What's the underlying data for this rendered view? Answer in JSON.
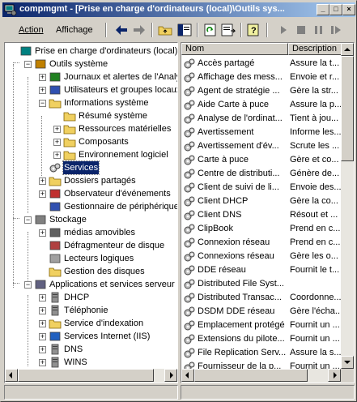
{
  "window": {
    "title": "compmgmt - [Prise en charge d'ordinateurs (local)\\Outils sys...",
    "controls": {
      "minimize": "_",
      "maximize": "□",
      "close": "×"
    }
  },
  "menu": [
    {
      "label": "Action"
    },
    {
      "label": "Affichage"
    }
  ],
  "toolbar": [
    "back-arrow-icon",
    "forward-arrow-icon",
    "up-folder-icon",
    "show-hide-tree-icon",
    "refresh-icon",
    "export-list-icon",
    "help-icon",
    "play-icon",
    "stop-icon",
    "pause-icon",
    "restart-icon"
  ],
  "tree": [
    {
      "label": "Prise en charge d'ordinateurs (local)",
      "icon": "computer-management-icon",
      "expander": ""
    },
    {
      "label": "Outils système",
      "icon": "tools-icon",
      "expander": "−"
    },
    {
      "label": "Journaux et alertes de l'Analyseur",
      "icon": "performance-logs-icon",
      "expander": "+"
    },
    {
      "label": "Utilisateurs et groupes locaux",
      "icon": "users-groups-icon",
      "expander": "+"
    },
    {
      "label": "Informations système",
      "icon": "folder-open-icon",
      "expander": "−"
    },
    {
      "label": "Résumé système",
      "icon": "folder-icon",
      "expander": ""
    },
    {
      "label": "Ressources matérielles",
      "icon": "folder-icon",
      "expander": "+"
    },
    {
      "label": "Composants",
      "icon": "folder-icon",
      "expander": "+"
    },
    {
      "label": "Environnement logiciel",
      "icon": "folder-icon",
      "expander": "+"
    },
    {
      "label": "Services",
      "icon": "services-gear-icon",
      "expander": "",
      "selected": true
    },
    {
      "label": "Dossiers partagés",
      "icon": "shared-folder-icon",
      "expander": "+"
    },
    {
      "label": "Observateur d'événements",
      "icon": "event-viewer-icon",
      "expander": "+"
    },
    {
      "label": "Gestionnaire de périphériques",
      "icon": "device-manager-icon",
      "expander": ""
    },
    {
      "label": "Stockage",
      "icon": "storage-icon",
      "expander": "−"
    },
    {
      "label": "médias amovibles",
      "icon": "removable-media-icon",
      "expander": "+"
    },
    {
      "label": "Défragmenteur de disque",
      "icon": "defrag-icon",
      "expander": ""
    },
    {
      "label": "Lecteurs logiques",
      "icon": "logical-drives-icon",
      "expander": ""
    },
    {
      "label": "Gestion des disques",
      "icon": "disk-management-icon",
      "expander": ""
    },
    {
      "label": "Applications et services serveur",
      "icon": "server-apps-icon",
      "expander": "−"
    },
    {
      "label": "DHCP",
      "icon": "server-icon",
      "expander": "+"
    },
    {
      "label": "Téléphonie",
      "icon": "server-icon",
      "expander": "+"
    },
    {
      "label": "Service d'indexation",
      "icon": "indexing-icon",
      "expander": "+"
    },
    {
      "label": "Services Internet (IIS)",
      "icon": "iis-icon",
      "expander": "+"
    },
    {
      "label": "DNS",
      "icon": "server-icon",
      "expander": "+"
    },
    {
      "label": "WINS",
      "icon": "server-icon",
      "expander": "+"
    }
  ],
  "list": {
    "columns": [
      "Nom",
      "Description"
    ],
    "rows": [
      {
        "name": "Accès partagé",
        "description": "Assure la t..."
      },
      {
        "name": "Affichage des mess...",
        "description": "Envoie et r..."
      },
      {
        "name": "Agent de stratégie ...",
        "description": "Gère la str..."
      },
      {
        "name": "Aide Carte à puce",
        "description": "Assure la p..."
      },
      {
        "name": "Analyse de l'ordinat...",
        "description": "Tient à jou..."
      },
      {
        "name": "Avertissement",
        "description": "Informe les..."
      },
      {
        "name": "Avertissement d'év...",
        "description": "Scrute les ..."
      },
      {
        "name": "Carte à puce",
        "description": "Gère et co..."
      },
      {
        "name": "Centre de distributi...",
        "description": "Génère de..."
      },
      {
        "name": "Client de suivi de li...",
        "description": "Envoie des..."
      },
      {
        "name": "Client DHCP",
        "description": "Gère la co..."
      },
      {
        "name": "Client DNS",
        "description": "Résout et ..."
      },
      {
        "name": "ClipBook",
        "description": "Prend en c..."
      },
      {
        "name": "Connexion réseau",
        "description": "Prend en c..."
      },
      {
        "name": "Connexions réseau",
        "description": "Gère les o..."
      },
      {
        "name": "DDE réseau",
        "description": "Fournit le t..."
      },
      {
        "name": "Distributed File Syst...",
        "description": ""
      },
      {
        "name": "Distributed Transac...",
        "description": "Coordonne..."
      },
      {
        "name": "DSDM DDE réseau",
        "description": "Gère l'écha..."
      },
      {
        "name": "Emplacement protégé",
        "description": "Fournit un ..."
      },
      {
        "name": "Extensions du pilote...",
        "description": "Fournit un ..."
      },
      {
        "name": "File Replication Serv...",
        "description": "Assure la s..."
      },
      {
        "name": "Fournisseur de la p...",
        "description": "Fournit un ..."
      }
    ]
  }
}
